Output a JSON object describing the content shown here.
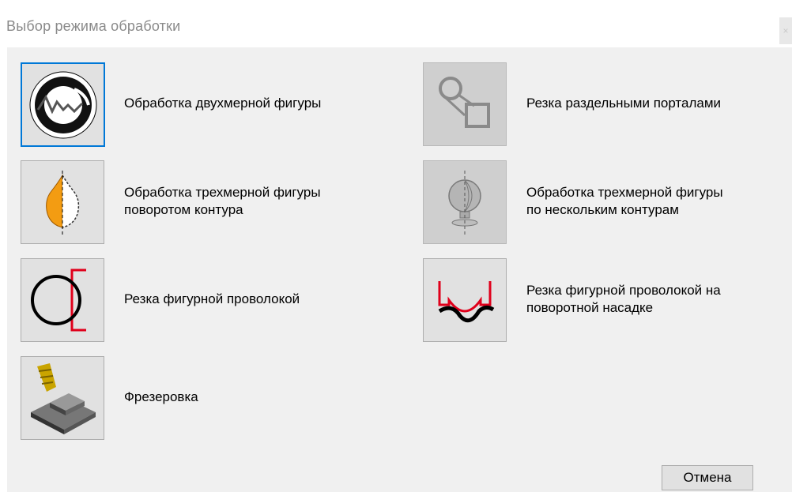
{
  "window": {
    "title": "Выбор режима обработки",
    "close_glyph": "×"
  },
  "modes": [
    {
      "label": "Обработка двухмерной фигуры",
      "icon": "2d-shape-icon"
    },
    {
      "label": "Резка раздельными порталами",
      "icon": "separate-portals-icon"
    },
    {
      "label": "Обработка трехмерной фигуры\nповоротом контура",
      "icon": "3d-rotate-contour-icon"
    },
    {
      "label": "Обработка трехмерной фигуры\nпо нескольким контурам",
      "icon": "3d-multi-contour-icon"
    },
    {
      "label": "Резка фигурной проволокой",
      "icon": "shaped-wire-icon"
    },
    {
      "label": "Резка фигурной проволокой на\nповоротной насадке",
      "icon": "shaped-wire-rotary-icon"
    },
    {
      "label": "Фрезеровка",
      "icon": "milling-icon"
    }
  ],
  "buttons": {
    "cancel": "Отмена"
  },
  "colors": {
    "focus": "#0078d7",
    "accent_red": "#e0001b",
    "accent_orange": "#f39c12"
  }
}
